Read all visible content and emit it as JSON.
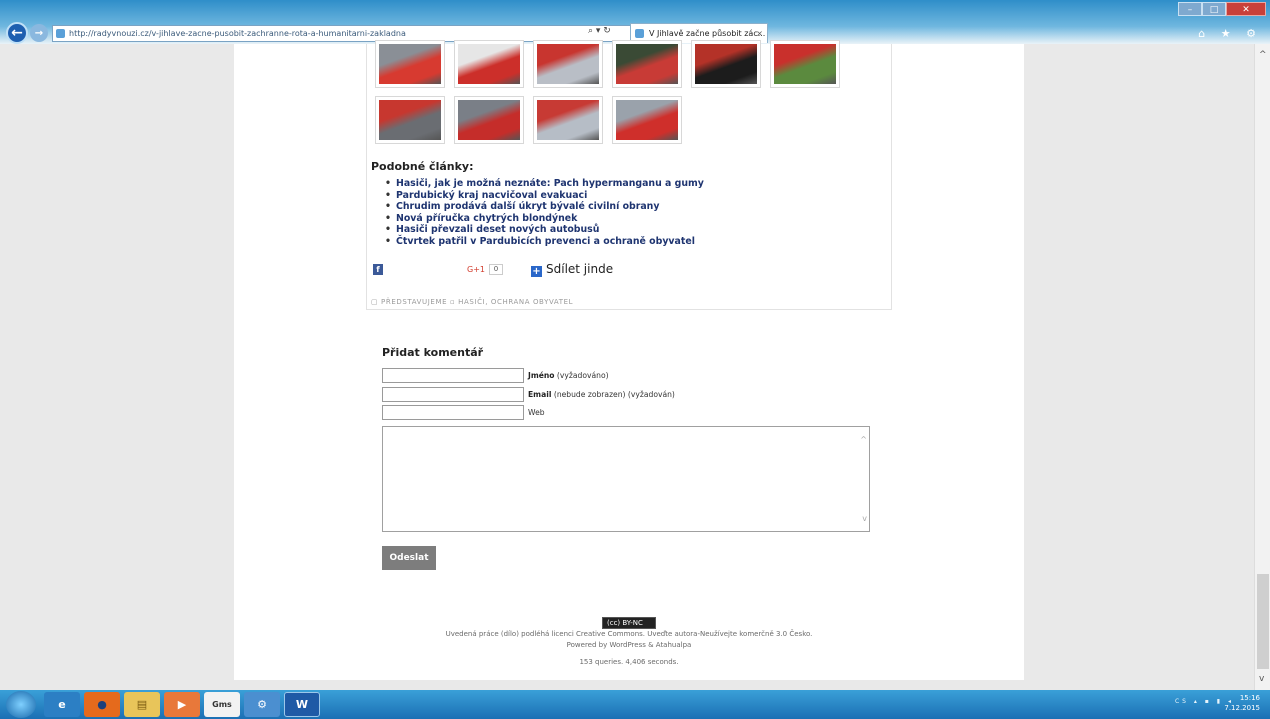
{
  "browser": {
    "url_host": "http://radyvnouzi.cz",
    "url_path": "/v-jihlave-zacne-pusobit-zachranne-rota-a-humanitarni-zakladna",
    "tab_title": "V Jihlavě začne působit zác...",
    "tab_close": "×",
    "back_glyph": "←",
    "forward_glyph": "→",
    "addr_controls": "⌕ ▾ ↻",
    "right_icons": "⌂ ★ ⚙",
    "minimize": "–",
    "maximize": "□",
    "close": "✕"
  },
  "gallery": {
    "photos": [
      {
        "c1": "#d73a30",
        "c2": "#8a8f96"
      },
      {
        "c1": "#cc2f2a",
        "c2": "#e6e6e6"
      },
      {
        "c1": "#b9bec6",
        "c2": "#c8352f"
      },
      {
        "c1": "#c83b36",
        "c2": "#3a4a35"
      },
      {
        "c1": "#1c1c1c",
        "c2": "#b43228"
      },
      {
        "c1": "#5b8a3e",
        "c2": "#c9302c"
      },
      {
        "c1": "#6a6d72",
        "c2": "#c7372f"
      },
      {
        "c1": "#c52d2a",
        "c2": "#7a7f87"
      },
      {
        "c1": "#b6bdc6",
        "c2": "#c73a34"
      },
      {
        "c1": "#cf2f2b",
        "c2": "#9aa2ab"
      }
    ]
  },
  "related": {
    "title": "Podobné články:",
    "items": [
      "Hasiči, jak je možná neznáte: Pach hypermanganu a gumy",
      "Pardubický kraj nacvičoval evakuaci",
      "Chrudim prodává další úkryt bývalé civilní obrany",
      "Nová příručka chytrých blondýnek",
      "Hasiči převzali deset nových autobusů",
      "Čtvrtek patřil v Pardubicích prevenci a ochraně obyvatel"
    ]
  },
  "share": {
    "fb_glyph": "f",
    "gplus": "G+1",
    "gplus_count": "0",
    "share_label": "Sdílet jinde",
    "share_glyph": "+"
  },
  "categories": "▢ PŘEDSTAVUJEME   ▫ HASIČI, OCHRANA OBYVATEL",
  "comment": {
    "title": "Přidat komentář",
    "name_label": "Jméno",
    "name_note": " (vyžadováno)",
    "email_label": "Email",
    "email_note": " (nebude zobrazen) (vyžadován)",
    "web_label": "Web",
    "submit": "Odeslat",
    "scroll_up": "^",
    "scroll_down": "v"
  },
  "footer": {
    "cc_badge": "(cc) BY-NC",
    "license": "Uvedená práce (dílo) podléhá licenci Creative Commons. Uveďte autora-Neužívejte komerčně 3.0 Česko.",
    "powered": "Powered by WordPress & Atahualpa",
    "queries": "153 queries. 4,406 seconds."
  },
  "scrollbar": {
    "up": "^",
    "down": "v"
  },
  "taskbar": {
    "items": [
      "",
      "e",
      "●",
      "▤",
      "▶",
      "Gms",
      "⚙",
      "W"
    ],
    "tray": "CS ▴ ▪ ▮ ◂",
    "time": "15:16",
    "date": "7.12.2015"
  }
}
